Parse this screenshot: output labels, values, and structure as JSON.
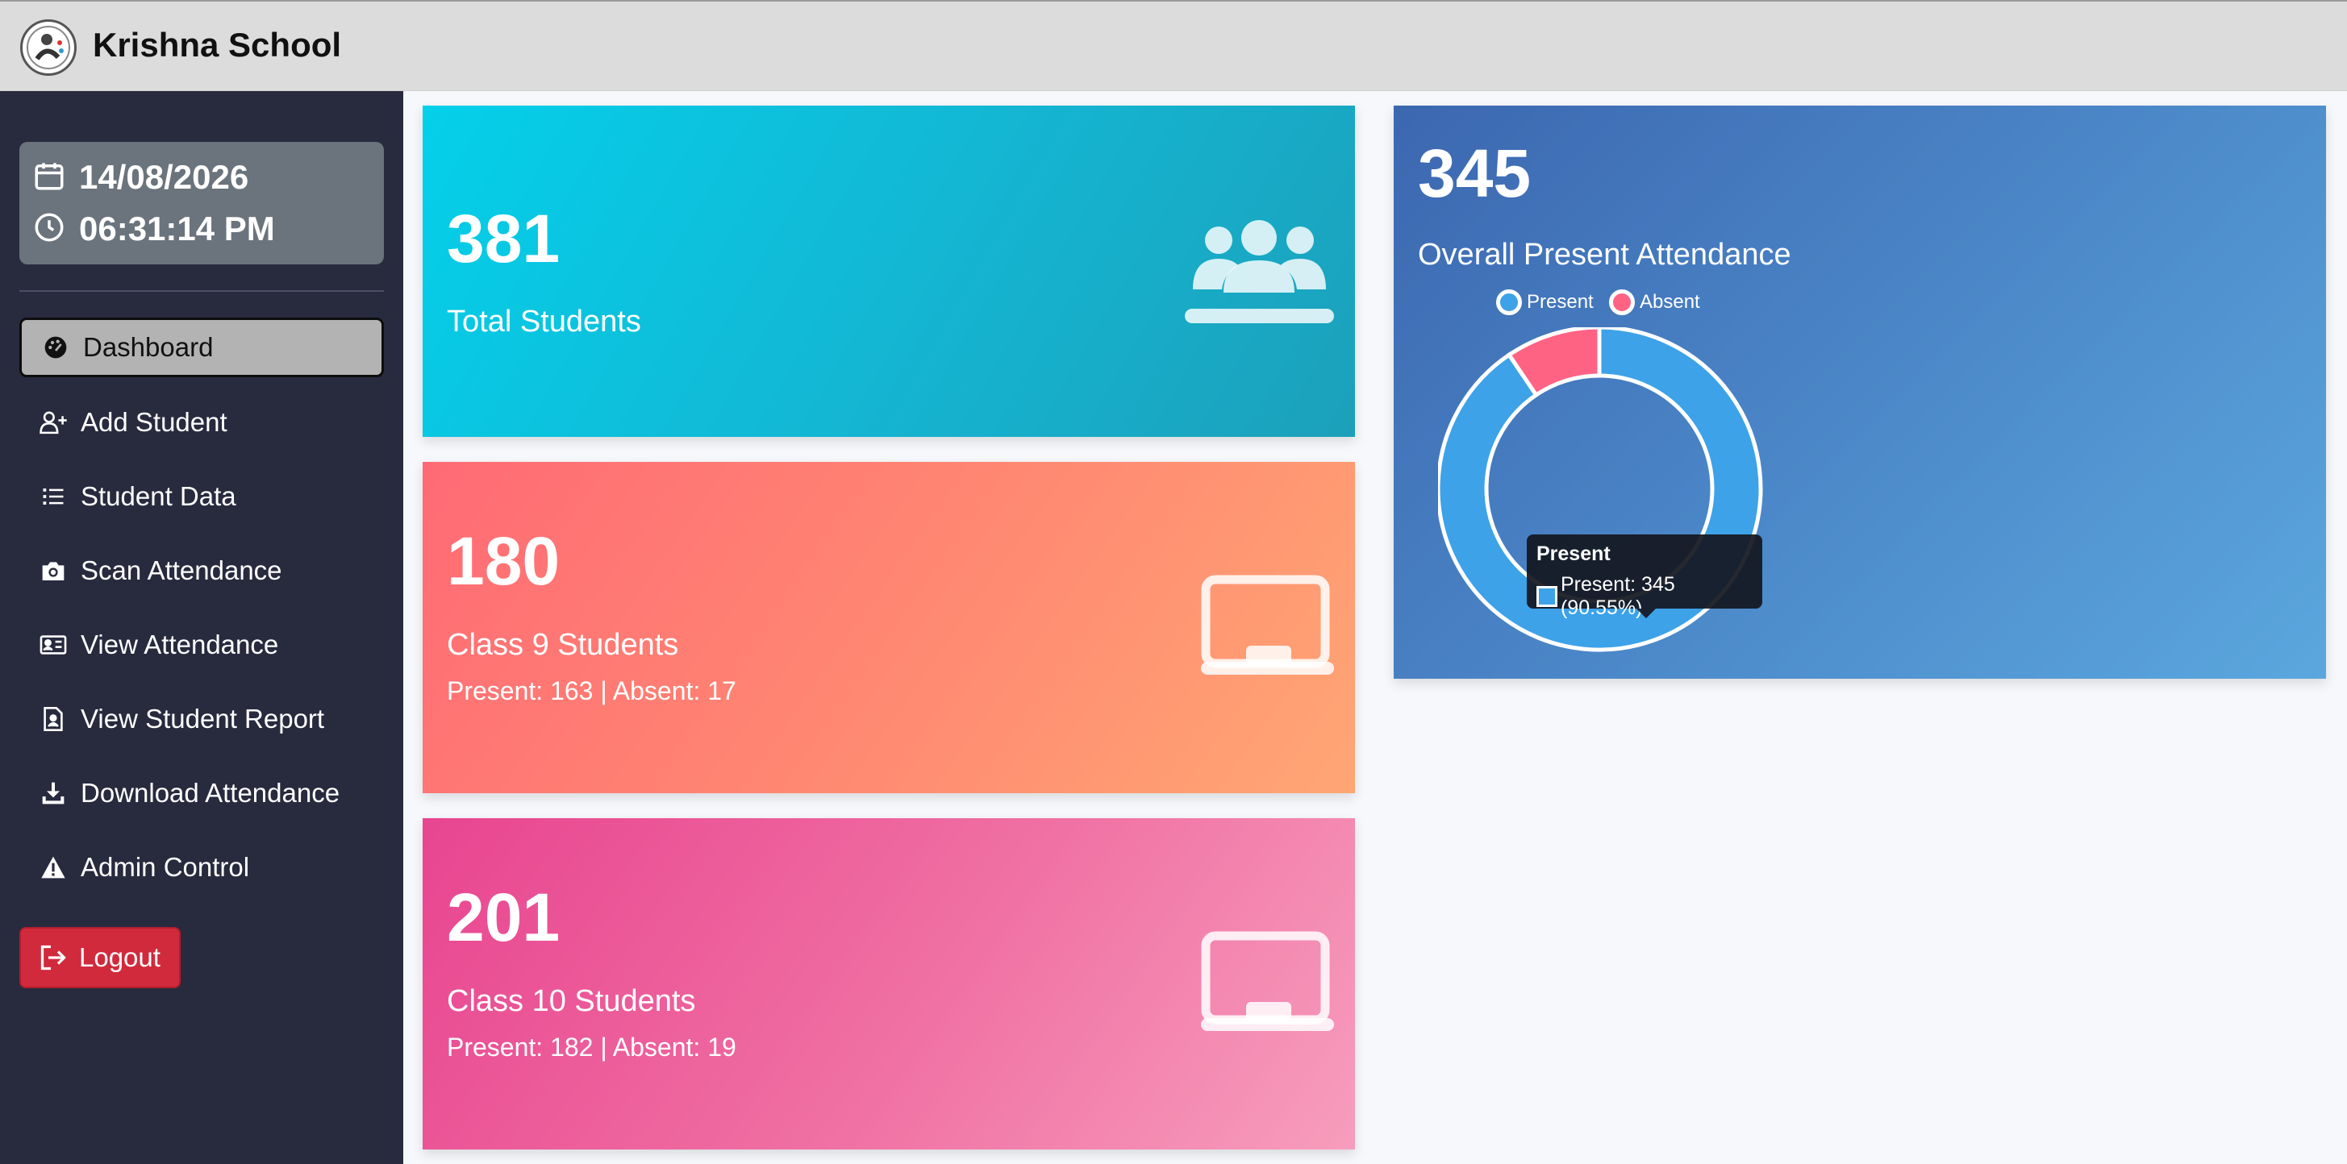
{
  "header": {
    "title": "Krishna School"
  },
  "sidebar": {
    "date": "14/08/2026",
    "time": "06:31:14 PM",
    "items": [
      {
        "label": "Dashboard",
        "icon": "dashboard-icon",
        "active": true
      },
      {
        "label": "Add Student",
        "icon": "add-user-icon"
      },
      {
        "label": "Student Data",
        "icon": "list-icon"
      },
      {
        "label": "Scan Attendance",
        "icon": "camera-icon"
      },
      {
        "label": "View Attendance",
        "icon": "id-card-icon"
      },
      {
        "label": "View Student Report",
        "icon": "report-icon"
      },
      {
        "label": "Download Attendance",
        "icon": "download-icon"
      },
      {
        "label": "Admin Control",
        "icon": "warning-icon"
      }
    ],
    "logout_label": "Logout"
  },
  "cards": {
    "total": {
      "value": "381",
      "label": "Total Students"
    },
    "class9": {
      "value": "180",
      "label": "Class 9 Students",
      "sub": "Present: 163 | Absent: 17"
    },
    "class10": {
      "value": "201",
      "label": "Class 10 Students",
      "sub": "Present: 182 | Absent: 19"
    },
    "attendance": {
      "value": "345",
      "label": "Overall Present Attendance"
    }
  },
  "colors": {
    "present": "#3da2e8",
    "absent": "#ff6384",
    "logout": "#d12a3c"
  },
  "chart_data": {
    "type": "pie",
    "variant": "doughnut",
    "categories": [
      "Present",
      "Absent"
    ],
    "values": [
      345,
      36
    ],
    "colors": [
      "#3da2e8",
      "#ff6384"
    ],
    "legend_position": "top"
  },
  "tooltip": {
    "title": "Present",
    "text": "Present: 345 (90.55%)"
  }
}
